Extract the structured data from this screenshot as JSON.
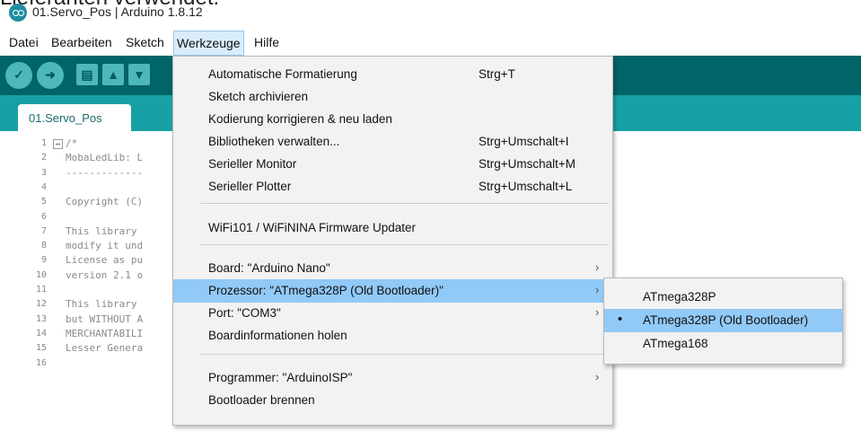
{
  "caption": "Lieferanten verwendet.",
  "window": {
    "title": "01.Servo_Pos | Arduino 1.8.12"
  },
  "menubar": {
    "items": [
      "Datei",
      "Bearbeiten",
      "Sketch",
      "Werkzeuge",
      "Hilfe"
    ]
  },
  "editor": {
    "tab": "01.Servo_Pos",
    "lines": [
      {
        "num": "1",
        "text": "/*"
      },
      {
        "num": "2",
        "text": "MobaLedLib: L"
      },
      {
        "num": "3",
        "text": "-------------"
      },
      {
        "num": "4",
        "text": ""
      },
      {
        "num": "5",
        "text": "Copyright (C)"
      },
      {
        "num": "6",
        "text": ""
      },
      {
        "num": "7",
        "text": "This library"
      },
      {
        "num": "8",
        "text": "modify it und"
      },
      {
        "num": "9",
        "text": "License as pu"
      },
      {
        "num": "10",
        "text": "version 2.1 o"
      },
      {
        "num": "11",
        "text": ""
      },
      {
        "num": "12",
        "text": "This library"
      },
      {
        "num": "13",
        "text": "but WITHOUT A"
      },
      {
        "num": "14",
        "text": "MERCHANTABILI"
      },
      {
        "num": "15",
        "text": "Lesser Genera"
      },
      {
        "num": "16",
        "text": ""
      }
    ]
  },
  "tools_menu": {
    "items": [
      {
        "label": "Automatische Formatierung",
        "shortcut": "Strg+T"
      },
      {
        "label": "Sketch archivieren",
        "shortcut": ""
      },
      {
        "label": "Kodierung korrigieren & neu laden",
        "shortcut": ""
      },
      {
        "label": "Bibliotheken verwalten...",
        "shortcut": "Strg+Umschalt+I"
      },
      {
        "label": "Serieller Monitor",
        "shortcut": "Strg+Umschalt+M"
      },
      {
        "label": "Serieller Plotter",
        "shortcut": "Strg+Umschalt+L"
      },
      {
        "label": "WiFi101 / WiFiNINA Firmware Updater",
        "shortcut": ""
      },
      {
        "label": "Board: \"Arduino Nano\"",
        "shortcut": ""
      },
      {
        "label": "Prozessor: \"ATmega328P (Old Bootloader)\"",
        "shortcut": ""
      },
      {
        "label": "Port: \"COM3\"",
        "shortcut": ""
      },
      {
        "label": "Boardinformationen holen",
        "shortcut": ""
      },
      {
        "label": "Programmer: \"ArduinoISP\"",
        "shortcut": ""
      },
      {
        "label": "Bootloader brennen",
        "shortcut": ""
      }
    ],
    "submenu_arrow": "›"
  },
  "processor_submenu": {
    "items": [
      "ATmega328P",
      "ATmega328P (Old Bootloader)",
      "ATmega168"
    ],
    "selected_marker": "•"
  }
}
